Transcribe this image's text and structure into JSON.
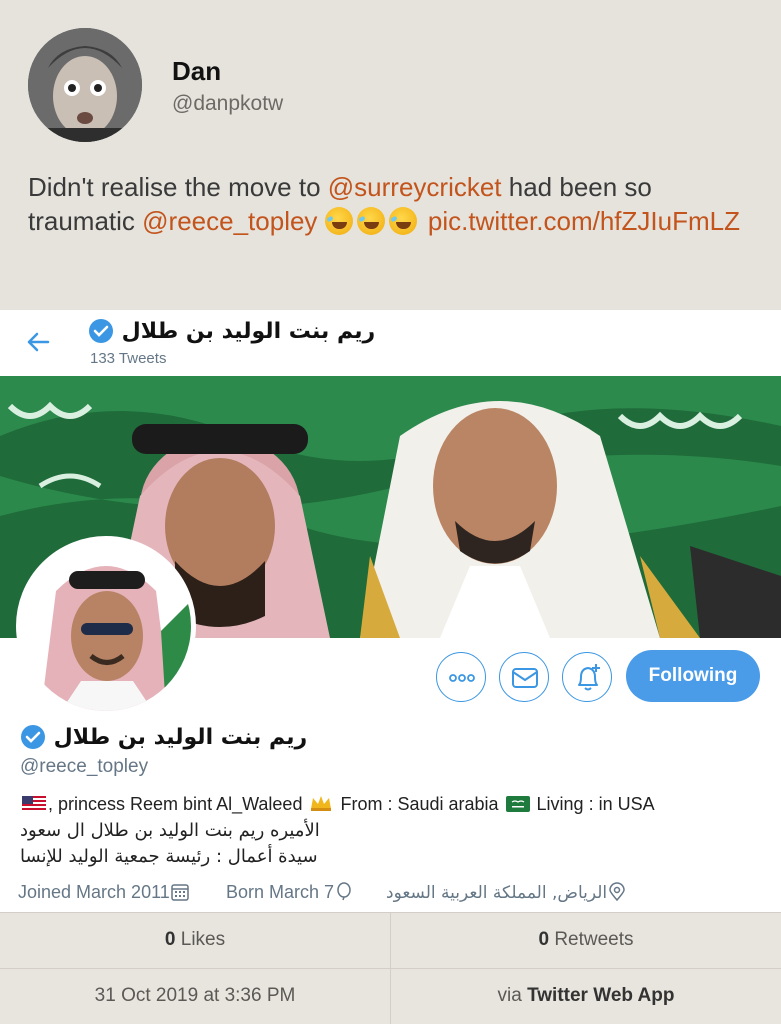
{
  "tweet": {
    "author_name": "Dan",
    "author_handle": "@danpkotw",
    "text_part1": "Didn't realise the move to ",
    "mention1": "@surreycricket",
    "text_part2": " had been so traumatic ",
    "mention2": "@reece_topley",
    "emoji_icon": "rolling-laughing-emoji",
    "link": "pic.twitter.com/hfZJIuFmLZ"
  },
  "screenshot": {
    "title": "ريم بنت الوليد بن طلال",
    "tweet_count": "133 Tweets",
    "following_label": "Following",
    "profile_name": "ريم بنت الوليد بن طلال",
    "profile_handle": "@reece_topley",
    "bio": {
      "part1": ", princess Reem bint Al_Waleed ",
      "part2": " From : Saudi arabia ",
      "part3": " Living : in USA",
      "line2": "الأميره ريم بنت الوليد بن طلال ال سعود",
      "line3": "سيدة أعمال : رئيسة جمعية الوليد للإنسا"
    },
    "joined": "Joined March 2011",
    "born": "Born March 7",
    "location": "الرياض, المملكة العربية السعود"
  },
  "stats": {
    "likes_count": "0",
    "likes_label": " Likes",
    "retweets_count": "0",
    "retweets_label": " Retweets",
    "timestamp": "31 Oct 2019 at 3:36 PM",
    "via_prefix": "via ",
    "via_app": "Twitter Web App"
  },
  "colors": {
    "mention": "#c2541c",
    "twitter_blue": "#4a9ce8",
    "background": "#e6e3dd"
  }
}
